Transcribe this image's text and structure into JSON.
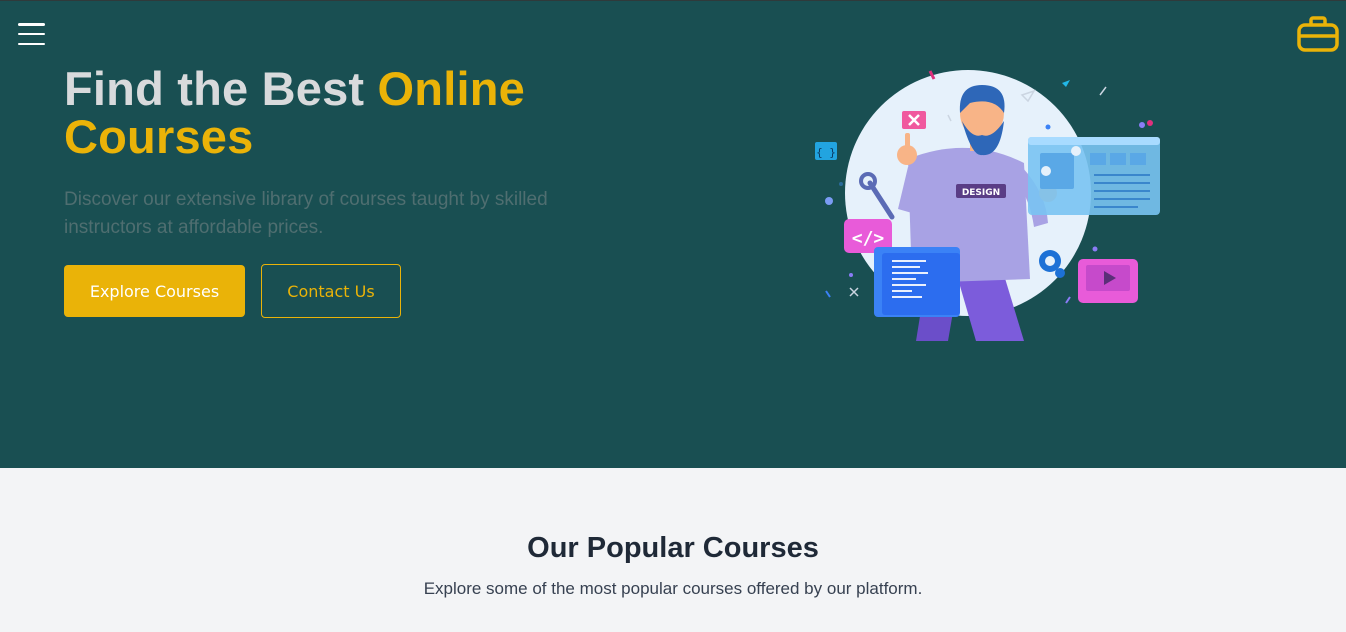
{
  "nav": {
    "menu_icon": "hamburger-menu-icon",
    "brand_icon": "briefcase-icon"
  },
  "hero": {
    "title_plain": "Find the Best ",
    "title_accent_1": "Online",
    "title_accent_2": "Courses",
    "subtitle": "Discover our extensive library of courses taught by skilled instructors at affordable prices.",
    "explore_label": "Explore Courses",
    "contact_label": "Contact Us",
    "illustration_badge": "DESIGN"
  },
  "colors": {
    "hero_bg": "#194f52",
    "accent": "#eab308",
    "page_bg": "#f3f4f6"
  },
  "popular": {
    "title": "Our Popular Courses",
    "subtitle": "Explore some of the most popular courses offered by our platform."
  }
}
